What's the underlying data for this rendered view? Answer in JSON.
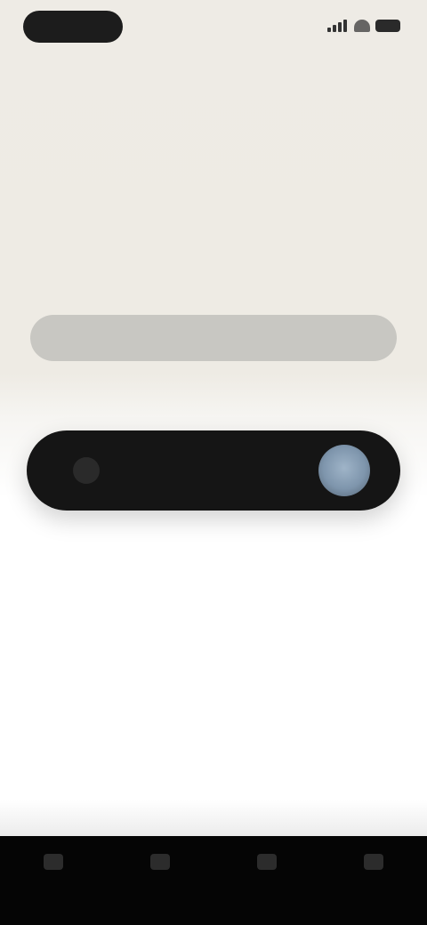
{
  "status_bar": {
    "time": "",
    "icons": [
      "signal-icon",
      "wifi-icon",
      "battery-icon"
    ]
  },
  "header": {
    "eyebrow": "",
    "subtitle": ""
  },
  "headline": {
    "line_1": "",
    "line_2": ""
  },
  "light_pill": {
    "label": ""
  },
  "cta": {
    "label": "",
    "left_icon": "lock-icon",
    "avatar": "profile-avatar"
  },
  "section": {
    "title": "",
    "body": ""
  },
  "bottom_nav": {
    "items": [
      {
        "label": "",
        "icon": "home-icon"
      },
      {
        "label": "",
        "icon": "discover-icon"
      },
      {
        "label": "",
        "icon": "chat-icon"
      },
      {
        "label": "",
        "icon": "profile-icon"
      }
    ]
  },
  "colors": {
    "background_top": "#eeebe5",
    "cta_background": "#151515",
    "avatar_accent": "#8ea3b8",
    "bottom_bar": "#050505"
  }
}
